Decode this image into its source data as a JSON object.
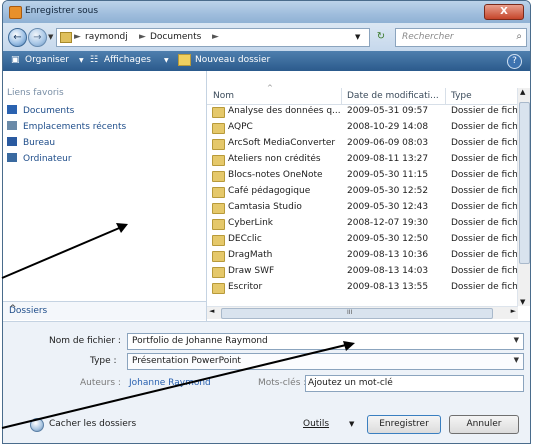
{
  "window": {
    "title": "Enregistrer sous",
    "close": "X"
  },
  "nav": {
    "back": "←",
    "forward": "→",
    "history_dropdown": "▼",
    "breadcrumb": [
      "raymondj",
      "Documents"
    ],
    "separator": "►",
    "address_dropdown": "▼",
    "refresh": "↻",
    "search_placeholder": "Rechercher",
    "search_icon": "⌕"
  },
  "toolbar": {
    "organize": "Organiser",
    "views": "Affichages",
    "new_folder": "Nouveau dossier",
    "dropdown": "▼",
    "help": "?"
  },
  "sidebar": {
    "heading": "Liens favoris",
    "items": [
      {
        "label": "Documents",
        "icon": "documents-icon",
        "color": "#2a62b0"
      },
      {
        "label": "Emplacements récents",
        "icon": "recent-places-icon",
        "color": "#6a8aa8"
      },
      {
        "label": "Bureau",
        "icon": "desktop-icon",
        "color": "#2a5aa0"
      },
      {
        "label": "Ordinateur",
        "icon": "computer-icon",
        "color": "#3a6aa0"
      }
    ],
    "folders_label": "Dossiers",
    "folders_caret": "^"
  },
  "files": {
    "columns": [
      "Nom",
      "Date de modificati...",
      "Type"
    ],
    "sort_indicator": "^",
    "rows": [
      {
        "name": "Analyse des données q...",
        "date": "2009-05-31 09:57",
        "type": "Dossier de fichi"
      },
      {
        "name": "AQPC",
        "date": "2008-10-29 14:08",
        "type": "Dossier de fichi"
      },
      {
        "name": "ArcSoft MediaConverter",
        "date": "2009-06-09 08:03",
        "type": "Dossier de fichi"
      },
      {
        "name": "Ateliers non crédités",
        "date": "2009-08-11 13:27",
        "type": "Dossier de fichi"
      },
      {
        "name": "Blocs-notes OneNote",
        "date": "2009-05-30 11:15",
        "type": "Dossier de fichi"
      },
      {
        "name": "Café pédagogique",
        "date": "2009-05-30 12:52",
        "type": "Dossier de fichi"
      },
      {
        "name": "Camtasia Studio",
        "date": "2009-05-30 12:43",
        "type": "Dossier de fichi"
      },
      {
        "name": "CyberLink",
        "date": "2008-12-07 19:30",
        "type": "Dossier de fichi"
      },
      {
        "name": "DECclic",
        "date": "2009-05-30 12:50",
        "type": "Dossier de fichi"
      },
      {
        "name": "DragMath",
        "date": "2009-08-13 10:36",
        "type": "Dossier de fichi"
      },
      {
        "name": "Draw SWF",
        "date": "2009-08-13 14:03",
        "type": "Dossier de fichi"
      },
      {
        "name": "Escritor",
        "date": "2009-08-13 13:55",
        "type": "Dossier de fichi"
      }
    ],
    "scroll_left": "◄",
    "scroll_right": "►",
    "scroll_grip": "III"
  },
  "form": {
    "filename_label": "Nom de fichier :",
    "filename_value": "Portfolio de Johanne Raymond",
    "type_label": "Type :",
    "type_value": "Présentation PowerPoint",
    "authors_label": "Auteurs :",
    "authors_value": "Johanne Raymond",
    "keywords_label": "Mots-clés :",
    "keywords_value": "Ajoutez un mot-clé",
    "dropdown": "▼"
  },
  "footer": {
    "hide_folders": "Cacher les dossiers",
    "tools": "Outils",
    "tools_dropdown": "▼",
    "save": "Enregistrer",
    "cancel": "Annuler"
  }
}
